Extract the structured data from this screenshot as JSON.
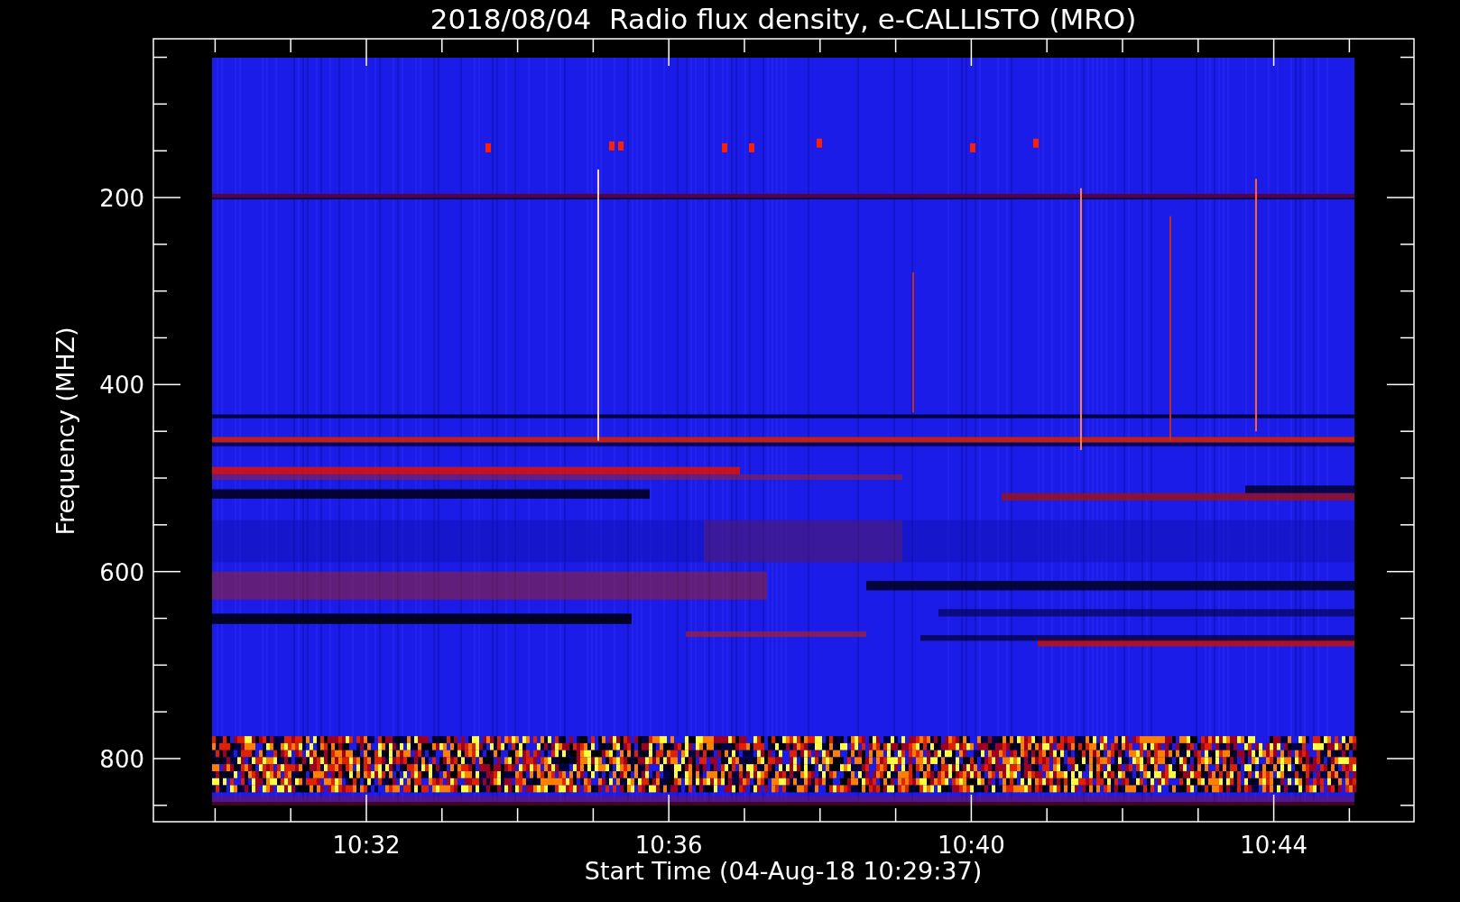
{
  "title": "2018/08/04  Radio flux density, e-CALLISTO (MRO)",
  "ylabel": "Frequency (MHZ)",
  "xlabel": "Start Time (04-Aug-18 10:29:37)",
  "yticks": [
    "200",
    "400",
    "600",
    "800"
  ],
  "xticks": [
    "10:32",
    "10:36",
    "10:40",
    "10:44"
  ]
}
